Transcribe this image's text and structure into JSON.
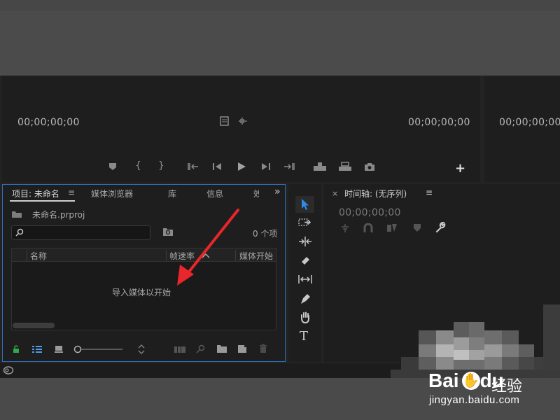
{
  "source_monitor": {
    "timecode_left": "00;00;00;00",
    "timecode_right": "00;00;00;00",
    "program_timecode": "00;00;00;00",
    "add_button": "+"
  },
  "project_panel": {
    "tabs": [
      {
        "label": "项目: 未命名",
        "active": true
      },
      {
        "label": "媒体浏览器",
        "active": false
      },
      {
        "label": "库",
        "active": false
      },
      {
        "label": "信息",
        "active": false
      },
      {
        "label": "效",
        "active": false
      }
    ],
    "menu_icon": "≡",
    "overflow_icon": "»",
    "project_file": "未命名.prproj",
    "search_value": "",
    "item_count": "0 个项",
    "columns": [
      "名称",
      "帧速率",
      "媒体开始"
    ],
    "empty_message": "导入媒体以开始"
  },
  "timeline_panel": {
    "close_icon": "×",
    "title": "时间轴: (无序列)",
    "menu_icon": "≡",
    "timecode": "00;00;00;00"
  },
  "watermark": {
    "brand": "Bai",
    "brand_suffix": "du",
    "product": "经验",
    "url": "jingyan.baidu.com"
  },
  "colors": {
    "panel_focus_border": "#2f6fbd",
    "arrow_annotation": "#e8262b",
    "selection_tool": "#2d8ceb",
    "lock_icon": "#2fa84a"
  }
}
